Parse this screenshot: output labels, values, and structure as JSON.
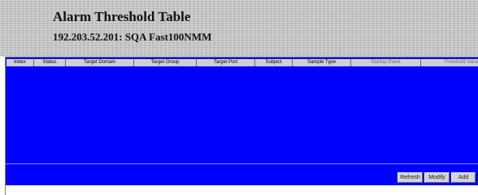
{
  "header": {
    "title": "Alarm Threshold Table",
    "subtitle": "192.203.52.201: SQA Fast100NMM"
  },
  "table": {
    "columns": [
      {
        "label": "Index"
      },
      {
        "label": "Status"
      },
      {
        "label": "Target Domain"
      },
      {
        "label": "Target Group"
      },
      {
        "label": "Target Port"
      },
      {
        "label": "Subject"
      },
      {
        "label": "Sample Type"
      },
      {
        "label": "Startup Event"
      },
      {
        "label": "Threshold Value"
      }
    ],
    "rows": []
  },
  "actions": {
    "refresh_label": "Refresh",
    "modify_label": "Modify",
    "add_label": "Add"
  },
  "colors": {
    "panel_background": "#0000ff",
    "header_texture": "#cbcbcb",
    "column_header": "#d0d0d0",
    "button_face": "#d4d4d4"
  }
}
